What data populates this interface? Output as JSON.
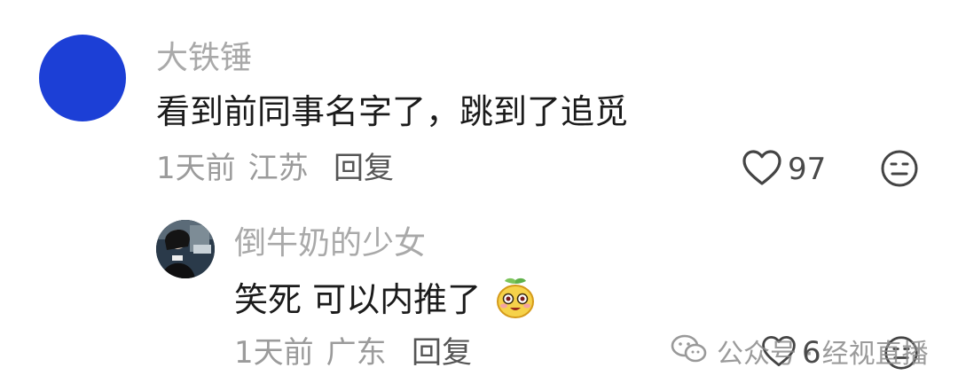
{
  "comments": [
    {
      "username": "大铁锤",
      "text": "看到前同事名字了，跳到了追觅",
      "time": "1天前",
      "location": "江苏",
      "reply_label": "回复",
      "likes": "97",
      "avatar_color": "#1c3fd6"
    }
  ],
  "reply": {
    "username": "倒牛奶的少女",
    "text": "笑死 可以内推了",
    "emoji": "smiling-mango-emoji",
    "time": "1天前",
    "location": "广东",
    "reply_label": "回复",
    "likes": "6"
  },
  "icons": {
    "like": "heart-outline-icon",
    "dislike": "meh-face-icon",
    "watermark": "wechat-icon"
  },
  "watermark": {
    "text": "公众号 · 经视直播"
  }
}
